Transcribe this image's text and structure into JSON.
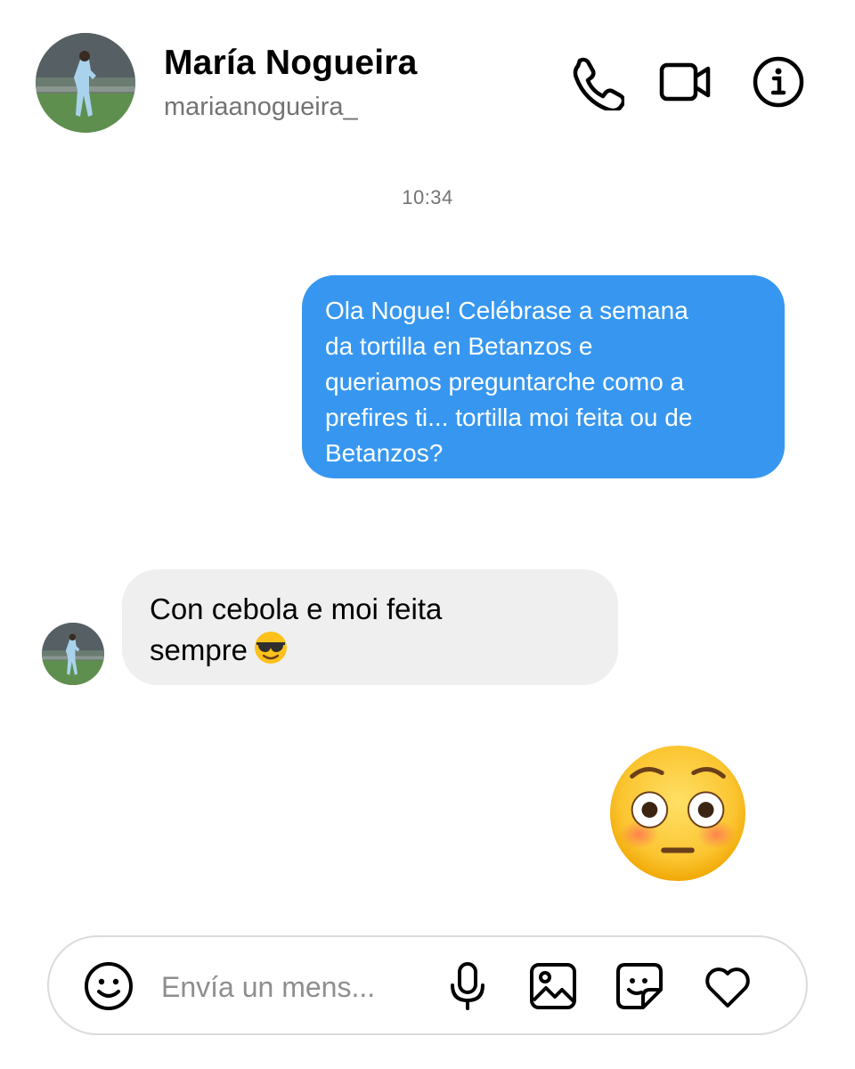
{
  "header": {
    "name": "María Nogueira",
    "username": "mariaanogueira_",
    "icons": [
      "avatar",
      "phone-icon",
      "video-camera-icon",
      "info-icon"
    ]
  },
  "thread": {
    "timestamp": "10:34",
    "messages": [
      {
        "direction": "outgoing",
        "lines": [
          "Ola Nogue! Celébrase a semana",
          "da tortilla en Betanzos e",
          "queriamos preguntarche como a",
          "prefires ti... tortilla moi feita ou de",
          "Betanzos?"
        ]
      },
      {
        "direction": "incoming",
        "lines": [
          "Con cebola e moi feita",
          "sempre"
        ],
        "emoji": "smiling-face-with-sunglasses"
      },
      {
        "direction": "outgoing",
        "emoji": "flushed-face"
      }
    ],
    "colors": {
      "outgoing_bubble": "#3797f0",
      "incoming_bubble": "#efefef"
    }
  },
  "composer": {
    "placeholder": "Envía un mens...",
    "icons": [
      "emoji-icon",
      "microphone-icon",
      "gallery-icon",
      "sticker-icon",
      "heart-icon"
    ]
  }
}
